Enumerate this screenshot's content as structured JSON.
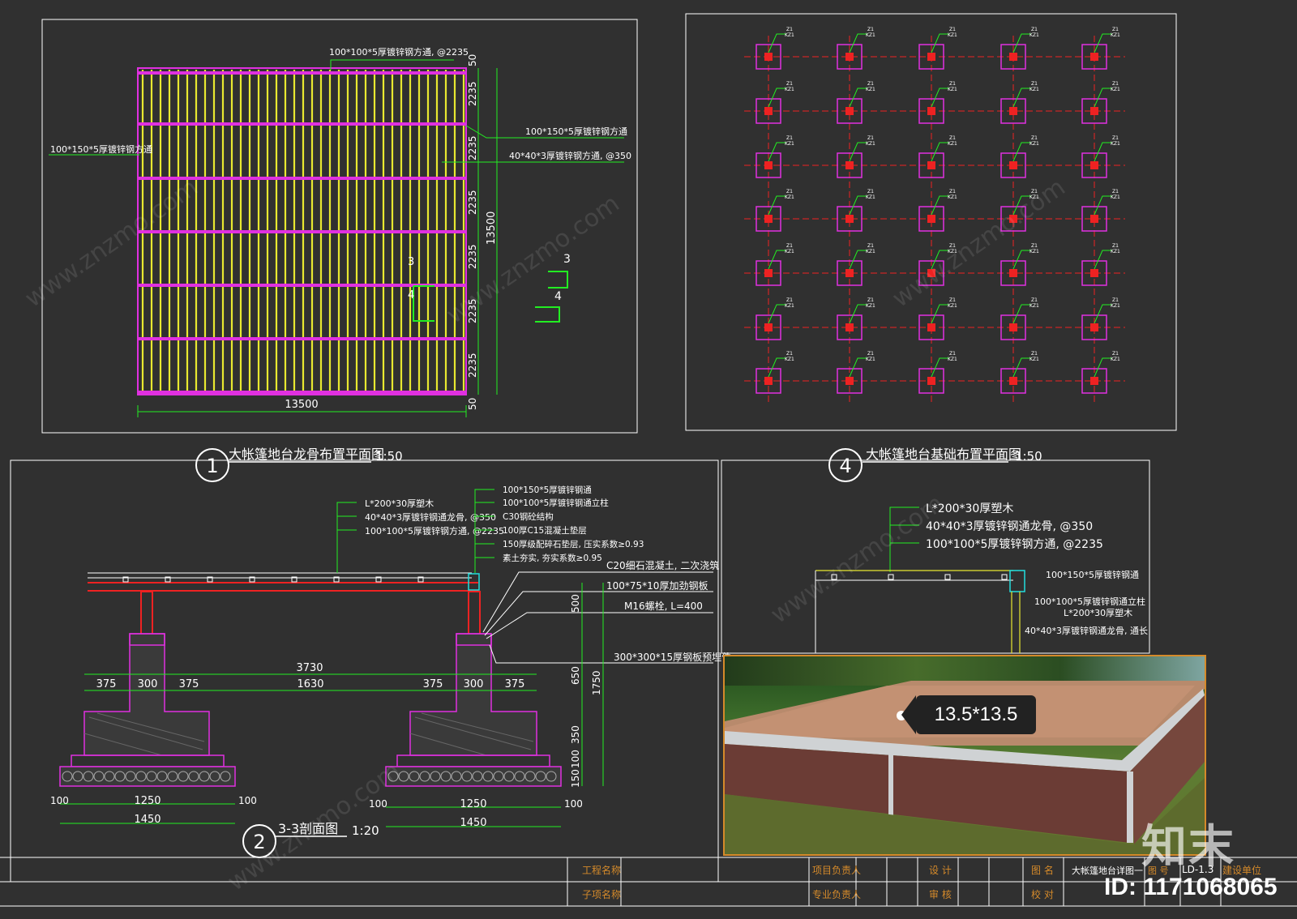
{
  "drawing1": {
    "number": "1",
    "title": "大帐篷地台龙骨布置平面图",
    "scale": "1:50",
    "note_top": "100*100*5厚镀锌钢方通, @2235",
    "note_left": "100*150*5厚镀锌钢方通",
    "note_right1": "100*150*5厚镀锌钢方通",
    "note_right2": "40*40*3厚镀锌钢方通, @350",
    "dim_total_h": "13500",
    "dim_total_v": "13500",
    "dim_top": "50",
    "dim_bottom": "50",
    "dim_spacing": [
      "2235",
      "2235",
      "2235",
      "2235",
      "2235",
      "2235"
    ],
    "section_mark_num": "3",
    "section_mark_sub": "4"
  },
  "drawing4": {
    "number": "4",
    "title": "大帐篷地台基础布置平面图",
    "scale": "1:50",
    "pier_label_top": "Z1",
    "pier_label_bottom": "KZ1"
  },
  "drawing2": {
    "number": "2",
    "title": "3-3剖面图",
    "scale": "1:20",
    "notes_left": [
      "L*200*30厚塑木",
      "40*40*3厚镀锌钢通龙骨, @350",
      "100*100*5厚镀锌钢方通, @2235"
    ],
    "notes_right": [
      "100*150*5厚镀锌钢通",
      "100*100*5厚镀锌钢通立柱",
      "C30钢砼结构",
      "100厚C15混凝土垫层",
      "150厚级配碎石垫层, 压实系数≥0.93",
      "素土夯实, 夯实系数≥0.95"
    ],
    "callouts": [
      "C20细石混凝土, 二次浇筑",
      "100*75*10厚加劲钢板",
      "M16螺栓, L=400",
      "300*300*15厚钢板预埋件"
    ],
    "dims_top": {
      "total": "3730",
      "a": "375",
      "b": "300",
      "c": "375",
      "mid": "1630",
      "d": "375",
      "e": "300",
      "f": "375"
    },
    "dims_vert": [
      "500",
      "650",
      "350",
      "100",
      "150",
      "1750"
    ],
    "dims_bottom_left": {
      "side1": "100",
      "mid": "1250",
      "side2": "100",
      "total": "1450"
    },
    "dims_bottom_right": {
      "side1": "100",
      "mid": "1250",
      "side2": "100",
      "total": "1450"
    }
  },
  "drawing_detail": {
    "notes": [
      "L*200*30厚塑木",
      "40*40*3厚镀锌钢通龙骨, @350",
      "100*100*5厚镀锌钢方通, @2235"
    ],
    "notes_right": [
      "100*150*5厚镀锌钢通",
      "100*100*5厚镀锌钢通立柱",
      "L*200*30厚塑木",
      "40*40*3厚镀锌钢通龙骨, 通长"
    ]
  },
  "photo": {
    "size_label": "13.5*13.5"
  },
  "title_block": {
    "project_name": "工程名称",
    "sub_name": "子项名称",
    "project_lead": "项目负责人",
    "discipline_lead": "专业负责人",
    "design": "设 计",
    "review": "审 核",
    "drawing_name_label": "图 名",
    "check": "校 对",
    "drawing_name": "大帐篷地台详图一",
    "drawing_no_label": "图 号",
    "drawing_no": "LD-1.3",
    "client": "建设单位"
  },
  "watermark": {
    "logo": "知末",
    "id": "ID: 1171068065",
    "site": "www.znzmo.com"
  },
  "colors": {
    "background": "#303030",
    "frame": "#ffffff",
    "green": "#22ee22",
    "magenta": "#e030e0",
    "yellow": "#e8e830",
    "red": "#ee2222",
    "cyan": "#22dddd",
    "text": "#ffffff"
  }
}
